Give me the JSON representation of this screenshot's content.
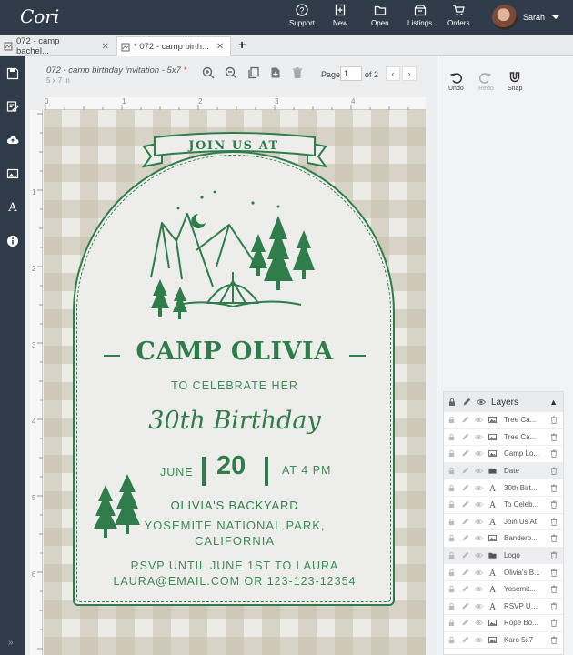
{
  "app": {
    "logo": "Cori",
    "nav": [
      {
        "label": "Support",
        "icon": "help-icon"
      },
      {
        "label": "New",
        "icon": "new-file-icon"
      },
      {
        "label": "Open",
        "icon": "folder-icon"
      },
      {
        "label": "Listings",
        "icon": "listings-icon"
      },
      {
        "label": "Orders",
        "icon": "cart-icon"
      }
    ],
    "user": {
      "name": "Sarah"
    }
  },
  "tabs": [
    {
      "label": "072 - camp bachel...",
      "active": false
    },
    {
      "label": "* 072 - camp birth...",
      "active": true
    }
  ],
  "document": {
    "title": "072 - camp birthday invitation - 5x7",
    "modified_marker": "*",
    "size": "5 x 7 in",
    "page_label": "Page",
    "page_current": "1",
    "page_of": "of 2"
  },
  "ruler": {
    "top": [
      "0",
      "1",
      "2",
      "3",
      "4"
    ],
    "left": [
      "1",
      "2",
      "3",
      "4",
      "5",
      "6"
    ]
  },
  "invitation": {
    "banner": "JOIN US AT",
    "title": "CAMP OLIVIA",
    "celebrate": "TO CELEBRATE HER",
    "script": "30th Birthday",
    "date_month": "JUNE",
    "date_day": "20",
    "date_time": "AT 4 PM",
    "venue": "OLIVIA'S BACKYARD",
    "address_line1": "YOSEMITE NATIONAL PARK,",
    "address_line2": "CALIFORNIA",
    "rsvp_line1": "RSVP UNTIL JUNE 1ST TO LAURA",
    "rsvp_line2": "LAURA@EMAIL.COM OR 123-123-12354"
  },
  "history": {
    "undo": "Undo",
    "redo": "Redo",
    "snap": "Snap"
  },
  "layers": {
    "title": "Layers",
    "items": [
      {
        "name": "Tree Ca...",
        "type": "image"
      },
      {
        "name": "Tree Ca...",
        "type": "image"
      },
      {
        "name": "Camp Lo...",
        "type": "image"
      },
      {
        "name": "Date",
        "type": "group"
      },
      {
        "name": "30th Birt...",
        "type": "text"
      },
      {
        "name": "To Celeb...",
        "type": "text"
      },
      {
        "name": "Join Us At",
        "type": "text"
      },
      {
        "name": "Bandero...",
        "type": "image"
      },
      {
        "name": "Logo",
        "type": "group"
      },
      {
        "name": "Olivia's B...",
        "type": "text"
      },
      {
        "name": "Yosemit...",
        "type": "text"
      },
      {
        "name": "RSVP UN...",
        "type": "text"
      },
      {
        "name": "Rope Bo...",
        "type": "image"
      },
      {
        "name": "Karo 5x7",
        "type": "image"
      }
    ]
  },
  "colors": {
    "accent_green": "#2f7d4a",
    "topbar": "#2f3b49"
  }
}
